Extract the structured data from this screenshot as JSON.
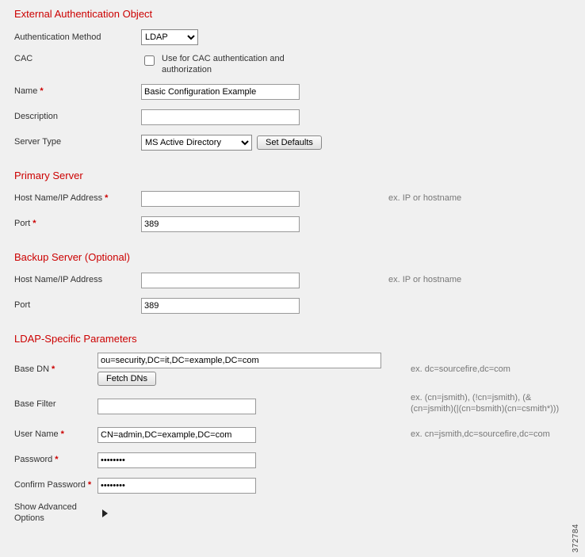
{
  "image_id": "372784",
  "sections": {
    "ext_auth": {
      "title": "External Authentication Object",
      "auth_method": {
        "label": "Authentication Method",
        "value": "LDAP"
      },
      "cac": {
        "label": "CAC",
        "checkbox_label": "Use for CAC authentication and authorization"
      },
      "name": {
        "label": "Name",
        "value": "Basic Configuration Example"
      },
      "description": {
        "label": "Description",
        "value": ""
      },
      "server_type": {
        "label": "Server Type",
        "value": "MS Active Directory",
        "button": "Set Defaults"
      }
    },
    "primary": {
      "title": "Primary Server",
      "host": {
        "label": "Host Name/IP Address",
        "value": "",
        "hint": "ex. IP or hostname"
      },
      "port": {
        "label": "Port",
        "value": "389"
      }
    },
    "backup": {
      "title": "Backup Server (Optional)",
      "host": {
        "label": "Host Name/IP Address",
        "value": "",
        "hint": "ex. IP or hostname"
      },
      "port": {
        "label": "Port",
        "value": "389"
      }
    },
    "ldap": {
      "title": "LDAP-Specific Parameters",
      "base_dn": {
        "label": "Base DN",
        "value": "ou=security,DC=it,DC=example,DC=com",
        "button": "Fetch DNs",
        "hint": "ex. dc=sourcefire,dc=com"
      },
      "base_filter": {
        "label": "Base Filter",
        "value": "",
        "hint": "ex. (cn=jsmith), (!cn=jsmith), (&(cn=jsmith)(|(cn=bsmith)(cn=csmith*)))"
      },
      "user_name": {
        "label": "User Name",
        "value": "CN=admin,DC=example,DC=com",
        "hint": "ex. cn=jsmith,dc=sourcefire,dc=com"
      },
      "password": {
        "label": "Password",
        "value": "••••••••"
      },
      "confirm_password": {
        "label": "Confirm Password",
        "value": "••••••••"
      },
      "advanced": {
        "label": "Show Advanced Options"
      }
    }
  }
}
